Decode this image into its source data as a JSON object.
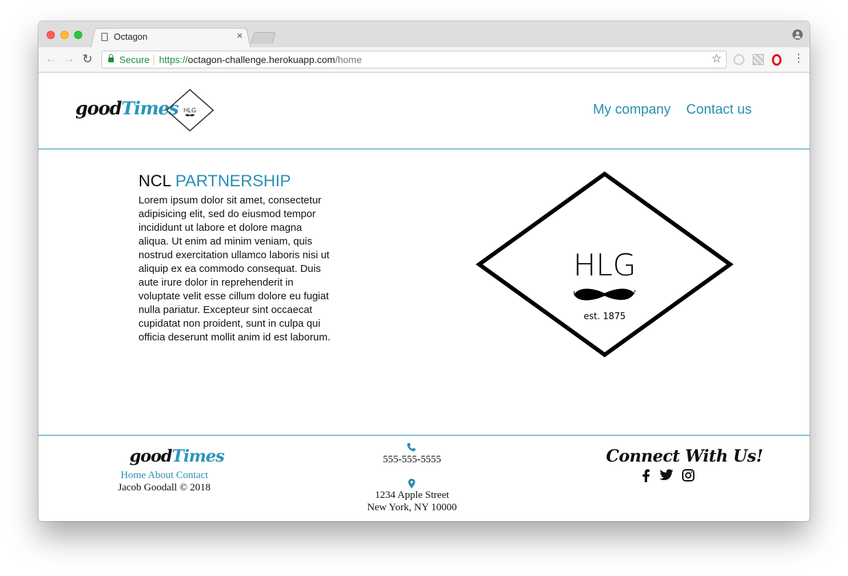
{
  "browser": {
    "tab_title": "Octagon",
    "tab_close": "×",
    "secure_label": "Secure",
    "url_scheme": "https://",
    "url_host": "octagon-challenge.herokuapp.com",
    "url_path": "/home"
  },
  "header": {
    "logo_good": "good",
    "logo_times": "Times",
    "nav": [
      "My company",
      "Contact us"
    ]
  },
  "badge": {
    "letters": "HLG",
    "est": "est. 1875"
  },
  "content": {
    "heading_plain": "NCL",
    "heading_accent": "PARTNERSHIP",
    "body": "Lorem ipsum dolor sit amet, consectetur adipisicing elit, sed do eiusmod tempor incididunt ut labore et dolore magna aliqua. Ut enim ad minim veniam, quis nostrud exercitation ullamco laboris nisi ut aliquip ex ea commodo consequat. Duis aute irure dolor in reprehenderit in voluptate velit esse cillum dolore eu fugiat nulla pariatur. Excepteur sint occaecat cupidatat non proident, sunt in culpa qui officia deserunt mollit anim id est laborum."
  },
  "footer": {
    "logo_good": "good",
    "logo_times": "Times",
    "links": [
      "Home",
      "About",
      "Contact"
    ],
    "copyright": "Jacob Goodall © 2018",
    "phone": "555-555-5555",
    "address_line1": "1234 Apple Street",
    "address_line2": "New York, NY 10000",
    "connect_title": "Connect With Us!",
    "social_icons": [
      "facebook-icon",
      "twitter-icon",
      "instagram-icon"
    ]
  },
  "colors": {
    "accent": "#2b8fb2",
    "text": "#111111"
  }
}
